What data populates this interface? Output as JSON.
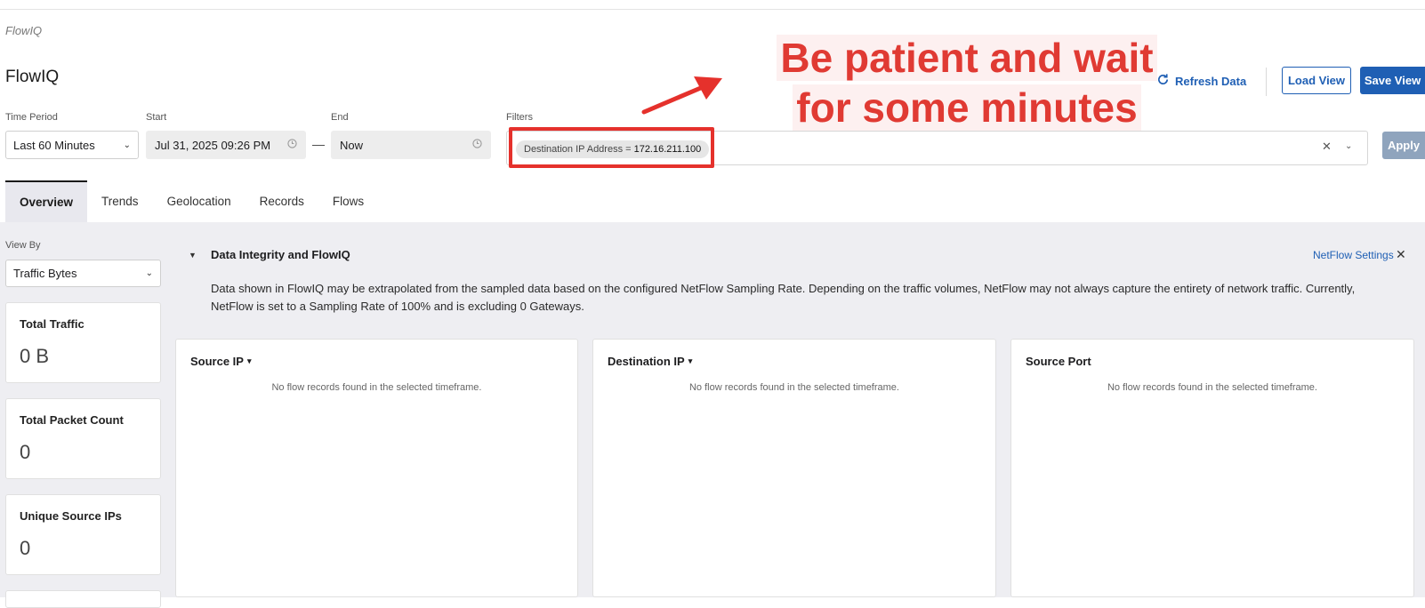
{
  "breadcrumb": "FlowIQ",
  "page_title": "FlowIQ",
  "actions": {
    "refresh_label": "Refresh Data",
    "load_view_label": "Load View",
    "save_view_label": "Save View"
  },
  "controls": {
    "time_period_label": "Time Period",
    "time_period_value": "Last 60 Minutes",
    "start_label": "Start",
    "start_value": "Jul 31, 2025 09:26 PM",
    "end_label": "End",
    "end_value": "Now",
    "filters_label": "Filters",
    "filter_chip_field": "Destination IP Address =",
    "filter_chip_value": "172.16.211.100",
    "apply_label": "Apply"
  },
  "annotation": {
    "text_line1": "Be patient and wait",
    "text_line2": "for some minutes",
    "color": "#e5312c"
  },
  "tabs": [
    {
      "label": "Overview"
    },
    {
      "label": "Trends"
    },
    {
      "label": "Geolocation"
    },
    {
      "label": "Records"
    },
    {
      "label": "Flows"
    }
  ],
  "active_tab": "Overview",
  "view_by": {
    "label": "View By",
    "value": "Traffic Bytes"
  },
  "stats": [
    {
      "title": "Total Traffic",
      "value": "0 B"
    },
    {
      "title": "Total Packet Count",
      "value": "0"
    },
    {
      "title": "Unique Source IPs",
      "value": "0"
    }
  ],
  "integrity": {
    "title": "Data Integrity and FlowIQ",
    "link": "NetFlow Settings",
    "body": "Data shown in FlowIQ may be extrapolated from the sampled data based on the configured NetFlow Sampling Rate. Depending on the traffic volumes, NetFlow may not always capture the entirety of network traffic. Currently, NetFlow is set to a Sampling Rate of 100% and is excluding 0 Gateways."
  },
  "panels": [
    {
      "title": "Source IP",
      "empty": "No flow records found in the selected timeframe."
    },
    {
      "title": "Destination IP",
      "empty": "No flow records found in the selected timeframe."
    },
    {
      "title": "Source Port",
      "empty": "No flow records found in the selected timeframe."
    }
  ],
  "colors": {
    "primary": "#1f5fb4",
    "annotation": "#e5312c",
    "apply_disabled": "#8fa4bd"
  }
}
